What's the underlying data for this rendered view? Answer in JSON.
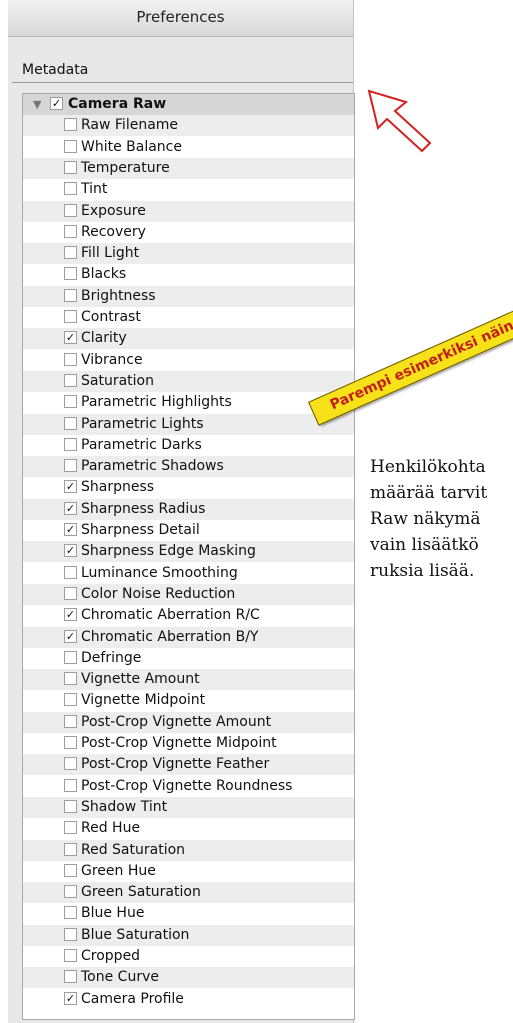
{
  "window": {
    "title": "Preferences"
  },
  "section_label": "Metadata",
  "group": {
    "label": "Camera Raw",
    "checked": true
  },
  "items": [
    {
      "label": "Raw Filename",
      "checked": false
    },
    {
      "label": "White Balance",
      "checked": false
    },
    {
      "label": "Temperature",
      "checked": false
    },
    {
      "label": "Tint",
      "checked": false
    },
    {
      "label": "Exposure",
      "checked": false
    },
    {
      "label": "Recovery",
      "checked": false
    },
    {
      "label": "Fill Light",
      "checked": false
    },
    {
      "label": "Blacks",
      "checked": false
    },
    {
      "label": "Brightness",
      "checked": false
    },
    {
      "label": "Contrast",
      "checked": false
    },
    {
      "label": "Clarity",
      "checked": true
    },
    {
      "label": "Vibrance",
      "checked": false
    },
    {
      "label": "Saturation",
      "checked": false
    },
    {
      "label": "Parametric Highlights",
      "checked": false
    },
    {
      "label": "Parametric Lights",
      "checked": false
    },
    {
      "label": "Parametric Darks",
      "checked": false
    },
    {
      "label": "Parametric Shadows",
      "checked": false
    },
    {
      "label": "Sharpness",
      "checked": true
    },
    {
      "label": "Sharpness Radius",
      "checked": true
    },
    {
      "label": "Sharpness Detail",
      "checked": true
    },
    {
      "label": "Sharpness Edge Masking",
      "checked": true
    },
    {
      "label": "Luminance Smoothing",
      "checked": false
    },
    {
      "label": "Color Noise Reduction",
      "checked": false
    },
    {
      "label": "Chromatic Aberration R/C",
      "checked": true
    },
    {
      "label": "Chromatic Aberration B/Y",
      "checked": true
    },
    {
      "label": "Defringe",
      "checked": false
    },
    {
      "label": "Vignette Amount",
      "checked": false
    },
    {
      "label": "Vignette Midpoint",
      "checked": false
    },
    {
      "label": "Post-Crop Vignette Amount",
      "checked": false
    },
    {
      "label": "Post-Crop Vignette Midpoint",
      "checked": false
    },
    {
      "label": "Post-Crop Vignette Feather",
      "checked": false
    },
    {
      "label": "Post-Crop Vignette Roundness",
      "checked": false
    },
    {
      "label": "Shadow Tint",
      "checked": false
    },
    {
      "label": "Red Hue",
      "checked": false
    },
    {
      "label": "Red Saturation",
      "checked": false
    },
    {
      "label": "Green Hue",
      "checked": false
    },
    {
      "label": "Green Saturation",
      "checked": false
    },
    {
      "label": "Blue Hue",
      "checked": false
    },
    {
      "label": "Blue Saturation",
      "checked": false
    },
    {
      "label": "Cropped",
      "checked": false
    },
    {
      "label": "Tone Curve",
      "checked": false
    },
    {
      "label": "Camera Profile",
      "checked": true
    }
  ],
  "callout": {
    "text": "Parempi esimerkiksi näin"
  },
  "annotation_lines": [
    "Henkilökohta",
    "määrää tarvit",
    "Raw näkymä",
    "vain lisäätkö",
    "ruksia lisää."
  ],
  "colors": {
    "callout_bg": "#f7e21a",
    "callout_text": "#c21e1e",
    "arrow": "#d42020"
  },
  "icons": {
    "disclosure": "disclosure-triangle-icon",
    "check": "checkmark-icon",
    "arrow": "arrow-annotation-icon"
  }
}
